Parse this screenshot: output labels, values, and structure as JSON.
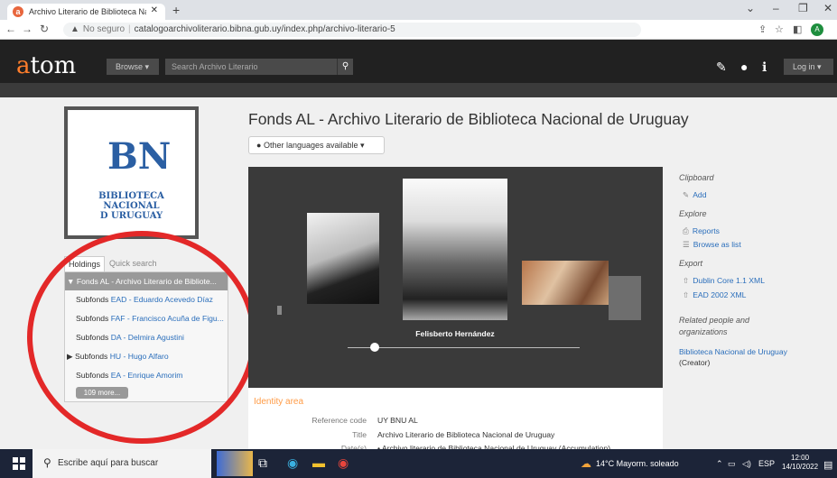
{
  "browser": {
    "tab_title": "Archivo Literario de Biblioteca Nacional",
    "tab_close": "✕",
    "new_tab": "+",
    "not_secure": "No seguro",
    "url": "catalogoarchivoliterario.bibna.gub.uy/index.php/archivo-literario-5"
  },
  "atom": {
    "logo_a": "a",
    "logo_rest": "tom",
    "browse_label": "Browse",
    "search_placeholder": "Search Archivo Literario",
    "login_label": "Log in"
  },
  "logo": {
    "monogram": "BN",
    "line1": "BIBLIOTECA",
    "line2": "NACIONAL",
    "line3": "D URUGUAY"
  },
  "tree": {
    "tab_holdings": "Holdings",
    "tab_quick": "Quick search",
    "items": [
      {
        "prefix": "▼ Fonds ",
        "link": "AL - Archivo Literario de Bibliote..."
      },
      {
        "prefix": "Subfonds ",
        "link": "EAD - Eduardo Acevedo Díaz"
      },
      {
        "prefix": "Subfonds ",
        "link": "FAF - Francisco Acuña de Figu..."
      },
      {
        "prefix": "Subfonds ",
        "link": "DA - Delmira Agustini"
      },
      {
        "prefix": "▶ Subfonds ",
        "link": "HU - Hugo Alfaro"
      },
      {
        "prefix": "Subfonds ",
        "link": "EA - Enrique Amorim"
      }
    ],
    "more": "109 more..."
  },
  "main": {
    "title": "Fonds AL - Archivo Literario de Biblioteca Nacional de Uruguay",
    "languages": "Other languages available",
    "caption": "Felisberto Hernández",
    "identity_heading": "Identity area",
    "fields": [
      {
        "label": "Reference code",
        "value": "UY BNU AL"
      },
      {
        "label": "Title",
        "value": "Archivo Literario de Biblioteca Nacional de Uruguay"
      },
      {
        "label": "Date(s)",
        "value": "• Archivo literario de Biblioteca Nacional de Uruguay (Accumulation)"
      }
    ]
  },
  "sidebar": {
    "clipboard": "Clipboard",
    "add": "Add",
    "explore": "Explore",
    "reports": "Reports",
    "browse_list": "Browse as list",
    "export": "Export",
    "dublin": "Dublin Core 1.1 XML",
    "ead": "EAD 2002 XML",
    "related": "Related people and organizations",
    "related_link": "Biblioteca Nacional de Uruguay",
    "related_role": " (Creator)"
  },
  "taskbar": {
    "search": "Escribe aquí para buscar",
    "weather": "14°C  Mayorm. soleado",
    "lang": "ESP",
    "time": "12:00",
    "date": "14/10/2022"
  }
}
